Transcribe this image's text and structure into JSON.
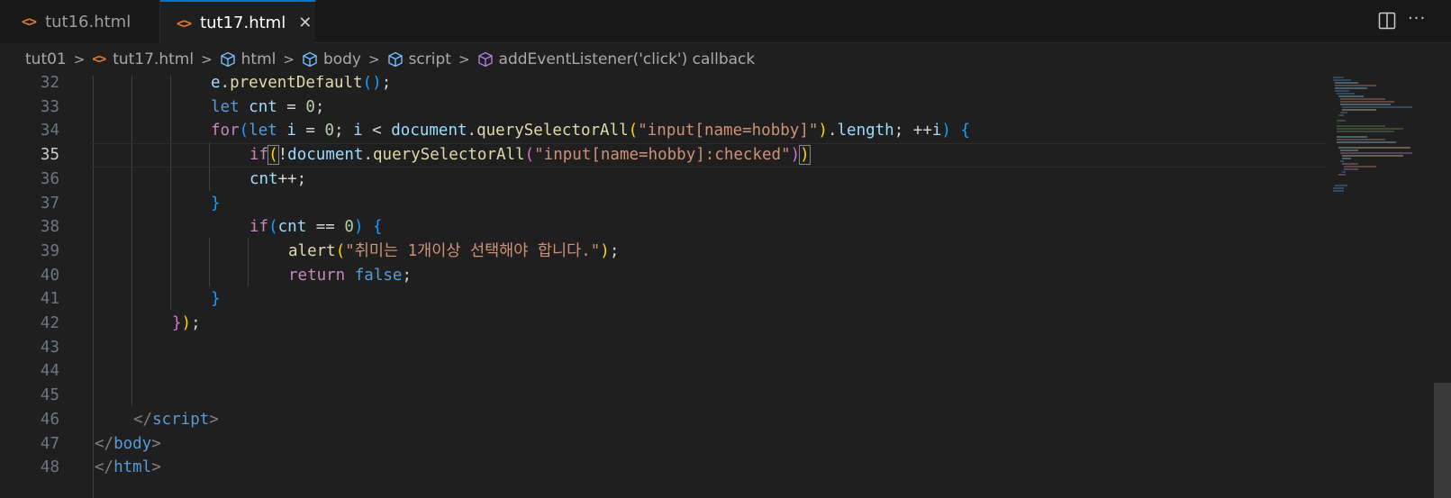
{
  "tabs": [
    {
      "label": "tut16.html",
      "active": false
    },
    {
      "label": "tut17.html",
      "active": true
    }
  ],
  "breadcrumb": [
    "tut01",
    "tut17.html",
    "html",
    "body",
    "script",
    "addEventListener('click') callback"
  ],
  "editor": {
    "active_line": 35,
    "lines": [
      {
        "n": "32",
        "parts": [
          [
            "var",
            "e"
          ],
          [
            "p",
            "."
          ],
          [
            "fn",
            "preventDefault"
          ],
          [
            "b3",
            "()"
          ],
          [
            "p",
            ";"
          ]
        ]
      },
      {
        "n": "33",
        "parts": [
          [
            "kw",
            "let "
          ],
          [
            "var",
            "cnt"
          ],
          [
            "p",
            " = "
          ],
          [
            "num",
            "0"
          ],
          [
            "p",
            ";"
          ]
        ]
      },
      {
        "n": "34",
        "parts": [
          [
            "ctl",
            "for"
          ],
          [
            "b3",
            "("
          ],
          [
            "kw",
            "let "
          ],
          [
            "var",
            "i"
          ],
          [
            "p",
            " = "
          ],
          [
            "num",
            "0"
          ],
          [
            "p",
            "; "
          ],
          [
            "var",
            "i"
          ],
          [
            "p",
            " < "
          ],
          [
            "var",
            "document"
          ],
          [
            "p",
            "."
          ],
          [
            "fn",
            "querySelectorAll"
          ],
          [
            "b1",
            "("
          ],
          [
            "str",
            "\"input[name=hobby]\""
          ],
          [
            "b1",
            ")"
          ],
          [
            "p",
            "."
          ],
          [
            "var",
            "length"
          ],
          [
            "p",
            "; ++"
          ],
          [
            "var",
            "i"
          ],
          [
            "b3",
            ")"
          ],
          [
            "p",
            " "
          ],
          [
            "b3",
            "{"
          ]
        ]
      },
      {
        "n": "35",
        "parts": [
          [
            "ctl",
            "if"
          ],
          [
            "b1",
            "("
          ],
          [
            "p",
            "!"
          ],
          [
            "var",
            "document"
          ],
          [
            "p",
            "."
          ],
          [
            "fn",
            "querySelectorAll"
          ],
          [
            "b2",
            "("
          ],
          [
            "str",
            "\"input[name=hobby]:checked\""
          ],
          [
            "b2",
            ")"
          ],
          [
            "b1",
            ")"
          ]
        ]
      },
      {
        "n": "36",
        "parts": [
          [
            "var",
            "cnt"
          ],
          [
            "p",
            "++;"
          ]
        ]
      },
      {
        "n": "37",
        "parts": [
          [
            "b3",
            "}"
          ]
        ]
      },
      {
        "n": "38",
        "parts": [
          [
            "ctl",
            "if"
          ],
          [
            "b3",
            "("
          ],
          [
            "var",
            "cnt"
          ],
          [
            "p",
            " == "
          ],
          [
            "num",
            "0"
          ],
          [
            "b3",
            ")"
          ],
          [
            "p",
            " "
          ],
          [
            "b3",
            "{"
          ]
        ]
      },
      {
        "n": "39",
        "parts": [
          [
            "fn",
            "alert"
          ],
          [
            "b1",
            "("
          ],
          [
            "str",
            "\"취미는 1개이상 선택해야 합니다.\""
          ],
          [
            "b1",
            ")"
          ],
          [
            "p",
            ";"
          ]
        ]
      },
      {
        "n": "40",
        "parts": [
          [
            "ctl",
            "return "
          ],
          [
            "kw",
            "false"
          ],
          [
            "p",
            ";"
          ]
        ]
      },
      {
        "n": "41",
        "parts": [
          [
            "b3",
            "}"
          ]
        ]
      },
      {
        "n": "42",
        "parts": [
          [
            "b2",
            "}"
          ],
          [
            "b1",
            ")"
          ],
          [
            "p",
            ";"
          ]
        ]
      },
      {
        "n": "43",
        "parts": []
      },
      {
        "n": "44",
        "parts": []
      },
      {
        "n": "45",
        "parts": []
      },
      {
        "n": "46",
        "parts": [
          [
            "tagb",
            "</"
          ],
          [
            "tag",
            "script"
          ],
          [
            "tagb",
            ">"
          ]
        ]
      },
      {
        "n": "47",
        "parts": [
          [
            "tagb",
            "</"
          ],
          [
            "tag",
            "body"
          ],
          [
            "tagb",
            ">"
          ]
        ]
      },
      {
        "n": "48",
        "parts": [
          [
            "tagb",
            "</"
          ],
          [
            "tag",
            "html"
          ],
          [
            "tagb",
            ">"
          ]
        ]
      }
    ]
  },
  "icons": {
    "tab_file": "html-file-icon",
    "close": "close-icon",
    "split": "split-editor-icon",
    "more": "more-actions-icon"
  },
  "colors": {
    "background": "#1f1f1f",
    "tabbar": "#181818",
    "active_tab_border": "#0078d4",
    "html_icon": "#e37933"
  }
}
